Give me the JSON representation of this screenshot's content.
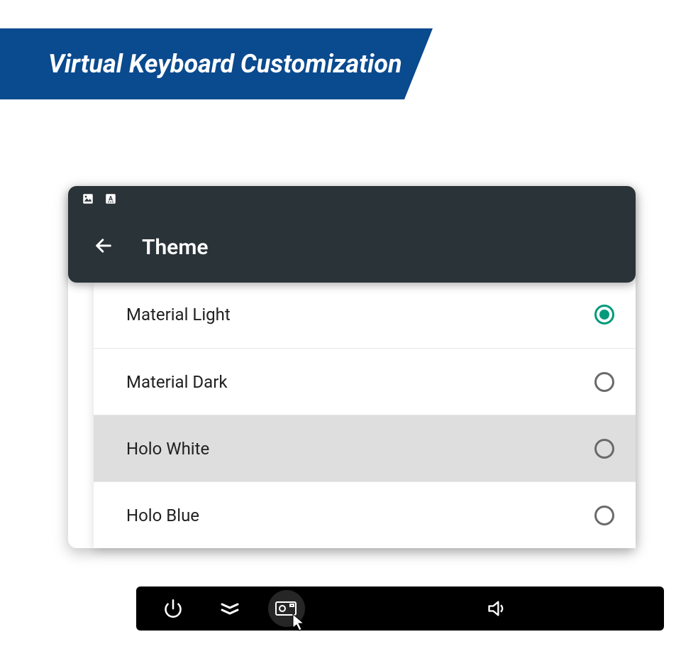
{
  "banner": {
    "title": "Virtual Keyboard Customization"
  },
  "screen": {
    "title": "Theme",
    "themes": [
      {
        "label": "Material Light",
        "selected": true,
        "hover": false
      },
      {
        "label": "Material Dark",
        "selected": false,
        "hover": false
      },
      {
        "label": "Holo White",
        "selected": false,
        "hover": true
      },
      {
        "label": "Holo Blue",
        "selected": false,
        "hover": false
      }
    ]
  },
  "navbar": {
    "icons": [
      "power",
      "expand",
      "screenshot",
      "volume"
    ],
    "active": "screenshot"
  },
  "colors": {
    "banner": "#0a4a8e",
    "header": "#2a3338",
    "accent": "#009a7b"
  }
}
